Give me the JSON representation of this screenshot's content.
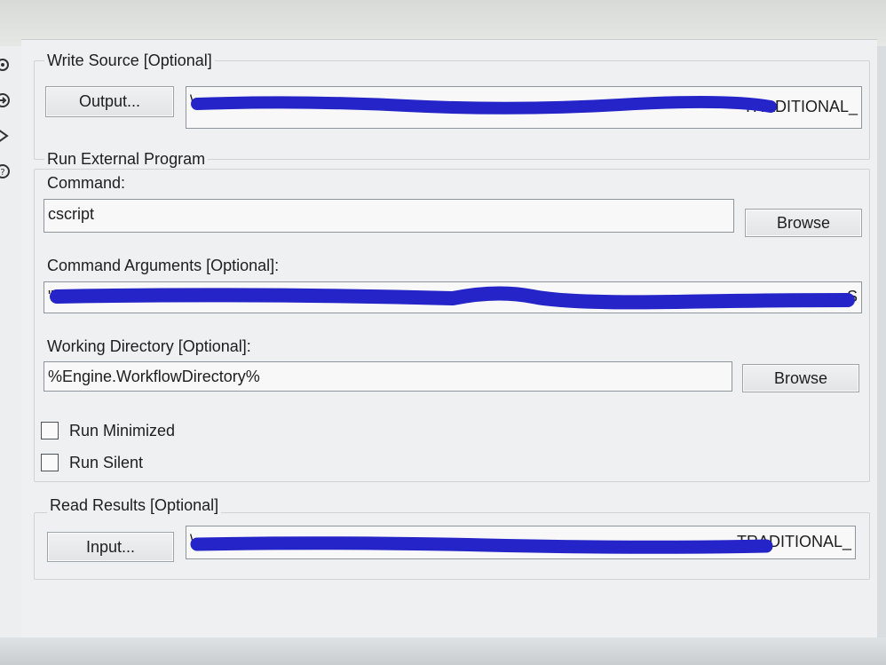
{
  "write_source": {
    "title": "Write Source [Optional]",
    "output_button_label": "Output...",
    "path_value_visible": "\\",
    "path_tail_visible": "TRADITIONAL_"
  },
  "run_external_program": {
    "title": "Run External Program",
    "command": {
      "label": "Command:",
      "value": "cscript",
      "browse_label": "Browse"
    },
    "command_arguments": {
      "label": "Command Arguments [Optional]:",
      "value_visible": "\"\\",
      "value_tail_visible": "S"
    },
    "working_directory": {
      "label": "Working Directory [Optional]:",
      "value": "%Engine.WorkflowDirectory%",
      "browse_label": "Browse"
    },
    "options": [
      {
        "label": "Run Minimized",
        "checked": false
      },
      {
        "label": "Run Silent",
        "checked": false
      }
    ]
  },
  "read_results": {
    "title": "Read Results [Optional]",
    "input_button_label": "Input...",
    "path_value_visible": "\\",
    "path_tail_visible": "TRADITIONAL_"
  },
  "colors": {
    "redaction": "#2424c8",
    "panel_bg": "#eef0f1"
  },
  "sidebar_icons": [
    "gear-icon",
    "arrow-icon",
    "diamond-icon",
    "help-icon"
  ]
}
